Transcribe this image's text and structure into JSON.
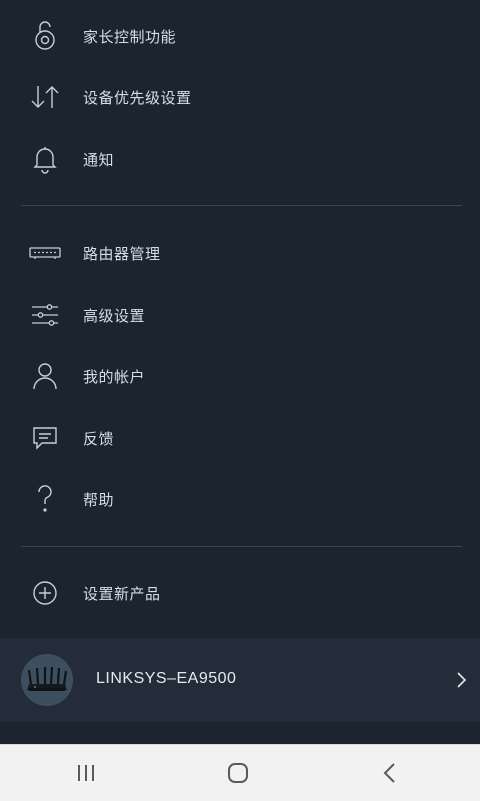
{
  "menu": {
    "items": [
      {
        "label": "家长控制功能",
        "icon": "parental-lock-icon"
      },
      {
        "label": "设备优先级设置",
        "icon": "arrows-up-down-icon"
      },
      {
        "label": "通知",
        "icon": "bell-icon"
      },
      {
        "label": "路由器管理",
        "icon": "router-icon"
      },
      {
        "label": "高级设置",
        "icon": "sliders-icon"
      },
      {
        "label": "我的帐户",
        "icon": "user-icon"
      },
      {
        "label": "反馈",
        "icon": "chat-icon"
      },
      {
        "label": "帮助",
        "icon": "question-icon"
      },
      {
        "label": "设置新产品",
        "icon": "plus-circle-icon"
      }
    ]
  },
  "device": {
    "name": "LINKSYS–EA9500",
    "icon": "router-avatar-icon"
  },
  "navbar": {
    "recent": "recent-apps-icon",
    "home": "home-icon",
    "back": "back-icon"
  },
  "colors": {
    "background": "#1c2430",
    "device_row": "#232c38",
    "divider": "#3a4350",
    "text": "#d8dde4",
    "navbar": "#f2f2f2"
  }
}
